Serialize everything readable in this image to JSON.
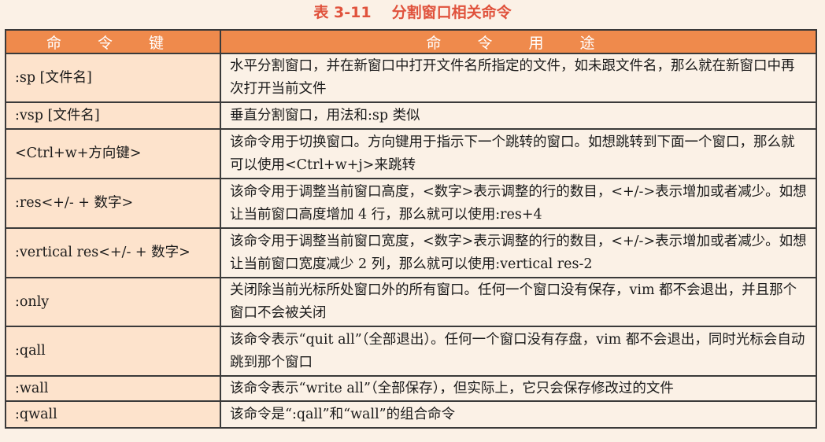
{
  "caption": {
    "number": "表 3-11",
    "title": "分割窗口相关命令"
  },
  "headers": {
    "key": "命 令 键",
    "usage": "命 令 用 途"
  },
  "rows": [
    {
      "key": ":sp [文件名]",
      "desc": "水平分割窗口，并在新窗口中打开文件名所指定的文件，如未跟文件名，那么就在新窗口中再次打开当前文件"
    },
    {
      "key": ":vsp [文件名]",
      "desc": "垂直分割窗口，用法和:sp 类似"
    },
    {
      "key": "<Ctrl+w+方向键>",
      "desc": "该命令用于切换窗口。方向键用于指示下一个跳转的窗口。如想跳转到下面一个窗口，那么就可以使用<Ctrl+w+j>来跳转"
    },
    {
      "key": ":res<+/- + 数字>",
      "desc": "该命令用于调整当前窗口高度，<数字>表示调整的行的数目，<+/->表示增加或者减少。如想让当前窗口高度增加 4 行，那么就可以使用:res+4"
    },
    {
      "key": ":vertical res<+/- + 数字>",
      "desc": "该命令用于调整当前窗口宽度，<数字>表示调整的行的数目，<+/->表示增加或者减少。如想让当前窗口宽度减少 2 列，那么就可以使用:vertical res-2"
    },
    {
      "key": ":only",
      "desc": "关闭除当前光标所处窗口外的所有窗口。任何一个窗口没有保存，vim 都不会退出，并且那个窗口不会被关闭"
    },
    {
      "key": ":qall",
      "desc": "该命令表示“quit all”（全部退出）。任何一个窗口没有存盘，vim 都不会退出，同时光标会自动跳到那个窗口"
    },
    {
      "key": ":wall",
      "desc": "该命令表示“write all”（全部保存），但实际上，它只会保存修改过的文件"
    },
    {
      "key": ":qwall",
      "desc": "该命令是“:qall”和“wall”的组合命令"
    }
  ]
}
